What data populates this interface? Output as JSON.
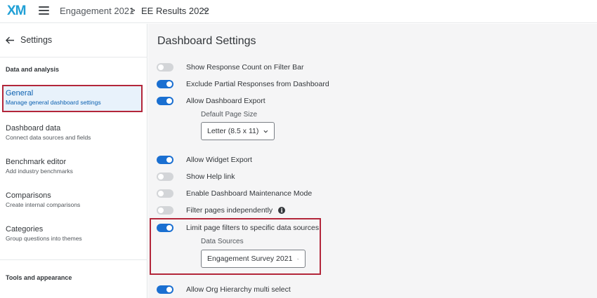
{
  "topbar": {
    "logo": "XM",
    "breadcrumb_project": "Engagement 2021",
    "breadcrumb_separator": ">",
    "breadcrumb_current": "EE Results 2022"
  },
  "sidebar": {
    "back_label": "Settings",
    "section_data": "Data and analysis",
    "section_tools": "Tools and appearance",
    "items": [
      {
        "title": "General",
        "desc": "Manage general dashboard settings"
      },
      {
        "title": "Dashboard data",
        "desc": "Connect data sources and fields"
      },
      {
        "title": "Benchmark editor",
        "desc": "Add industry benchmarks"
      },
      {
        "title": "Comparisons",
        "desc": "Create internal comparisons"
      },
      {
        "title": "Categories",
        "desc": "Group questions into themes"
      }
    ]
  },
  "main": {
    "title": "Dashboard Settings",
    "settings": [
      {
        "label": "Show Response Count on Filter Bar",
        "enabled": false
      },
      {
        "label": "Exclude Partial Responses from Dashboard",
        "enabled": true
      },
      {
        "label": "Allow Dashboard Export",
        "enabled": true
      },
      {
        "label": "Allow Widget Export",
        "enabled": true
      },
      {
        "label": "Show Help link",
        "enabled": false
      },
      {
        "label": "Enable Dashboard Maintenance Mode",
        "enabled": false
      },
      {
        "label": "Filter pages independently",
        "enabled": false
      },
      {
        "label": "Limit page filters to specific data sources",
        "enabled": true
      },
      {
        "label": "Allow Org Hierarchy multi select",
        "enabled": true
      }
    ],
    "page_size": {
      "label": "Default Page Size",
      "value": "Letter (8.5 x 11)"
    },
    "data_sources": {
      "label": "Data Sources",
      "value": "Engagement Survey 2021"
    }
  },
  "colors": {
    "accent": "#1a6fd1",
    "highlight": "#b3263a",
    "active_bg": "#e8f2fb"
  }
}
